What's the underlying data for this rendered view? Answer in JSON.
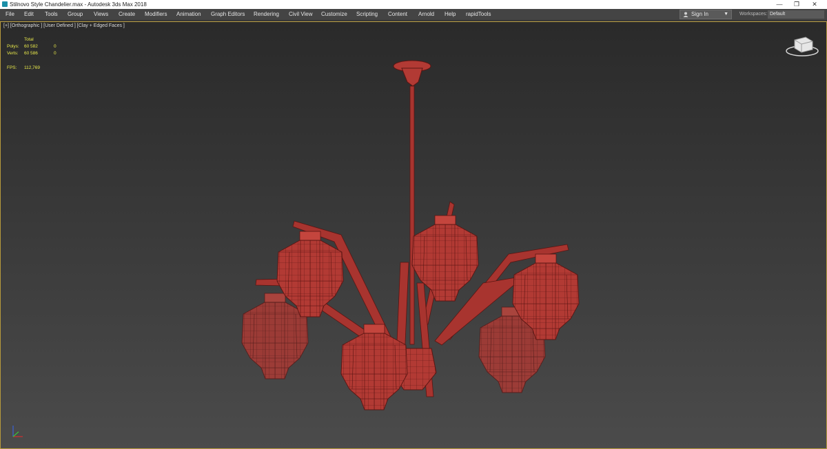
{
  "window": {
    "title": "Stilnovo Style Chandelier.max - Autodesk 3ds Max 2018",
    "minimize": "—",
    "restore": "❐",
    "close": "✕"
  },
  "menu": [
    "File",
    "Edit",
    "Tools",
    "Group",
    "Views",
    "Create",
    "Modifiers",
    "Animation",
    "Graph Editors",
    "Rendering",
    "Civil View",
    "Customize",
    "Scripting",
    "Content",
    "Arnold",
    "Help",
    "rapidTools"
  ],
  "account": {
    "sign_in": "Sign In"
  },
  "workspace": {
    "label": "Workspaces:",
    "value": "Default"
  },
  "viewport": {
    "label": "[+] [Orthographic ] [User Defined ] [Clay + Edged Faces ]",
    "stats": {
      "header": "Total",
      "polys_label": "Polys:",
      "polys_total": "60 582",
      "polys_sel": "0",
      "verts_label": "Verts:",
      "verts_total": "60 586",
      "verts_sel": "0",
      "fps_label": "FPS:",
      "fps_value": "112,769"
    }
  },
  "colors": {
    "model": "#b23a34",
    "wire": "#5a1512",
    "stats": "#e9e94a",
    "border": "#b79a3c"
  },
  "icons": [
    "app-icon",
    "user-icon",
    "viewcube-icon",
    "axis-tripod-icon"
  ]
}
